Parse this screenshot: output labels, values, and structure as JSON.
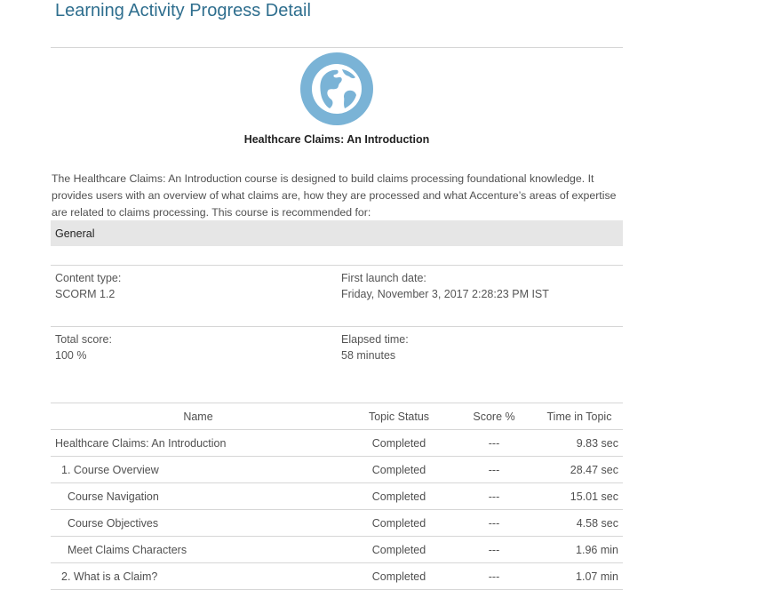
{
  "page": {
    "title": "Learning Activity Progress Detail"
  },
  "course": {
    "icon": "globe-icon",
    "name": "Healthcare Claims: An Introduction",
    "description": "The Healthcare Claims: An Introduction course is designed to build claims processing foundational knowledge. It provides users with an overview of what claims are, how they are processed and what Accenture’s areas of expertise are related to claims processing. This course is recommended for:",
    "audience": "General"
  },
  "details": {
    "content_type_label": "Content type:",
    "content_type_value": "SCORM 1.2",
    "first_launch_label": "First launch date:",
    "first_launch_value": "Friday, November 3, 2017 2:28:23 PM IST",
    "total_score_label": "Total score:",
    "total_score_value": "100 %",
    "elapsed_label": "Elapsed time:",
    "elapsed_value": "58 minutes"
  },
  "table": {
    "headers": {
      "name": "Name",
      "status": "Topic Status",
      "score": "Score %",
      "time": "Time in Topic"
    },
    "rows": [
      {
        "name": "Healthcare Claims: An Introduction",
        "status": "Completed",
        "score": "---",
        "time": "9.83 sec"
      },
      {
        "name": "1. Course Overview",
        "status": "Completed",
        "score": "---",
        "time": "28.47 sec"
      },
      {
        "name": "Course Navigation",
        "status": "Completed",
        "score": "---",
        "time": "15.01 sec"
      },
      {
        "name": "Course Objectives",
        "status": "Completed",
        "score": "---",
        "time": "4.58 sec"
      },
      {
        "name": "Meet Claims Characters",
        "status": "Completed",
        "score": "---",
        "time": "1.96 min"
      },
      {
        "name": "2. What is a Claim?",
        "status": "Completed",
        "score": "---",
        "time": "1.07 min"
      }
    ]
  },
  "colors": {
    "title": "#2e6e8e",
    "icon_blue": "#7ab3d6",
    "rule": "#d6d6d6",
    "audience_bg": "#e6e6e6"
  }
}
